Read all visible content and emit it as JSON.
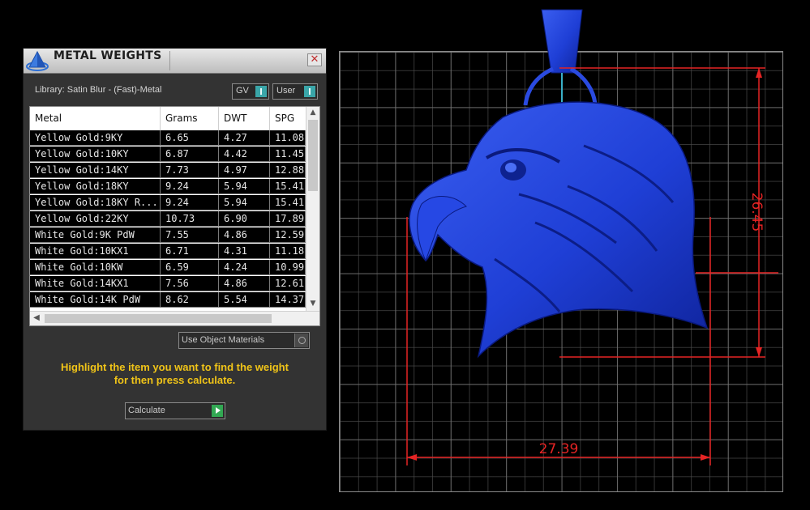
{
  "window": {
    "title": "METAL WEIGHTS",
    "close_glyph": "✕"
  },
  "library": {
    "label": "Library: Satin Blur - (Fast)-Metal"
  },
  "toggles": {
    "gv_label": "GV",
    "user_label": "User"
  },
  "table": {
    "columns": [
      "Metal",
      "Grams",
      "DWT",
      "SPG"
    ],
    "rows": [
      [
        "Yellow Gold:9KY",
        "6.65",
        "4.27",
        "11.08"
      ],
      [
        "Yellow Gold:10KY",
        "6.87",
        "4.42",
        "11.45"
      ],
      [
        "Yellow Gold:14KY",
        "7.73",
        "4.97",
        "12.88"
      ],
      [
        "Yellow Gold:18KY",
        "9.24",
        "5.94",
        "15.41"
      ],
      [
        "Yellow Gold:18KY R...",
        "9.24",
        "5.94",
        "15.41"
      ],
      [
        "Yellow Gold:22KY",
        "10.73",
        "6.90",
        "17.89"
      ],
      [
        "White Gold:9K PdW",
        "7.55",
        "4.86",
        "12.59"
      ],
      [
        "White Gold:10KX1",
        "6.71",
        "4.31",
        "11.18"
      ],
      [
        "White Gold:10KW",
        "6.59",
        "4.24",
        "10.99"
      ],
      [
        "White Gold:14KX1",
        "7.56",
        "4.86",
        "12.61"
      ],
      [
        "White Gold:14K PdW",
        "8.62",
        "5.54",
        "14.37"
      ]
    ]
  },
  "materials_dropdown": {
    "label": "Use Object Materials"
  },
  "hint": {
    "line1": "Highlight the item you want to find the weight",
    "line2": "for then press calculate."
  },
  "calculate": {
    "label": "Calculate"
  },
  "viewport": {
    "height_dimension": "26.45",
    "width_dimension": "27.39",
    "dimension_color": "#e52424",
    "model_color": "#1f3fd6"
  },
  "icons": {
    "logo": "pyramid-logo-icon",
    "close": "close-icon",
    "toggle": "toggle-switch-icon",
    "dropdown": "dropdown-circle-icon",
    "play": "play-icon",
    "scroll_up": "chevron-up-icon",
    "scroll_down": "chevron-down-icon",
    "scroll_left": "chevron-left-icon"
  }
}
